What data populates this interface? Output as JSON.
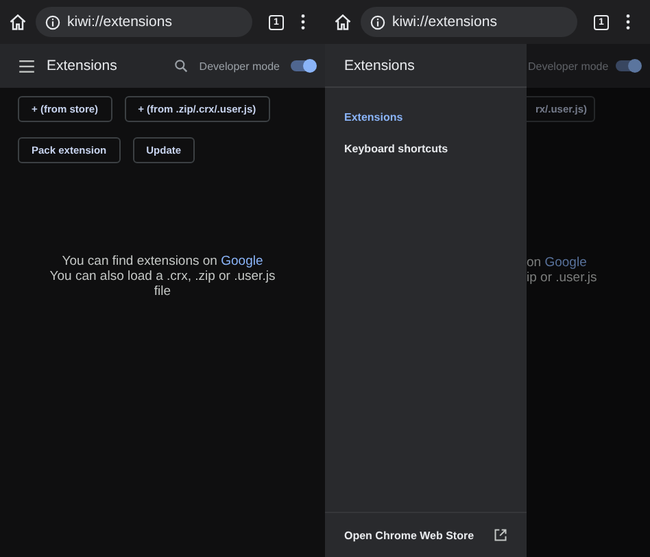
{
  "left_screen": {
    "address": "kiwi://extensions",
    "tab_count": "1",
    "header": {
      "title": "Extensions",
      "developer_mode_label": "Developer mode",
      "developer_mode_on": true
    },
    "button_rows": [
      [
        "+ (from store)",
        "+ (from .zip/.crx/.user.js)"
      ],
      [
        "Pack extension",
        "Update"
      ]
    ],
    "message": {
      "line1": "You can find extensions on",
      "link": "Google",
      "line2": "You can also load a .crx, .zip or .user.js file"
    }
  },
  "right_screen": {
    "address": "kiwi://extensions",
    "tab_count": "1",
    "drawer": {
      "title": "Extensions",
      "items": [
        {
          "label": "Extensions",
          "selected": true
        },
        {
          "label": "Keyboard shortcuts",
          "selected": false
        }
      ],
      "footer_link": "Open Chrome Web Store"
    },
    "behind": {
      "developer_mode_label": "Developer mode",
      "developer_mode_on": true,
      "button_fragment": "rx/.user.js)",
      "line1_tail": "on",
      "link": "Google",
      "line2_tail": "ip or .user.js"
    }
  }
}
